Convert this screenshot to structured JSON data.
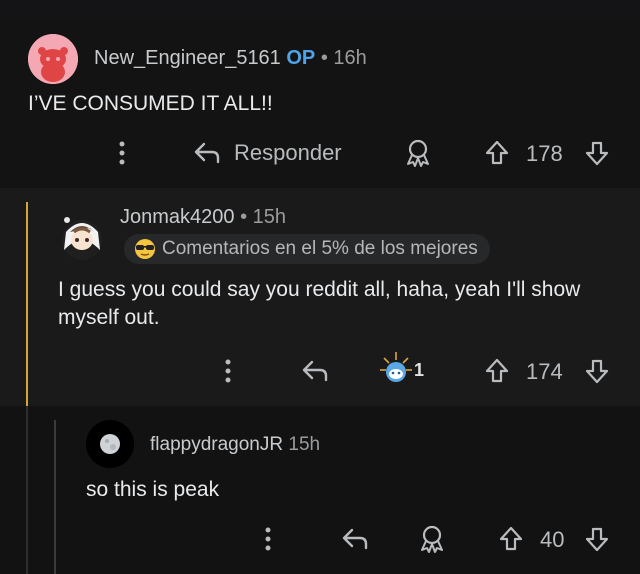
{
  "comments": [
    {
      "username": "New_Engineer_5161",
      "op_label": "OP",
      "separator": "•",
      "time": "16h",
      "body": "I’VE CONSUMED IT ALL!!",
      "reply_label": "Responder",
      "votes": "178",
      "icons": [
        "more-icon",
        "reply-icon",
        "award-icon",
        "upvote-icon",
        "downvote-icon"
      ]
    },
    {
      "username": "Jonmak4200",
      "separator": "•",
      "time": "15h",
      "badge": "Comentarios en el 5% de los mejores",
      "body": "I guess you could say you reddit all, haha, yeah I'll show myself out.",
      "award_count": "1",
      "votes": "174",
      "icons": [
        "more-icon",
        "reply-icon",
        "award-icon",
        "upvote-icon",
        "downvote-icon"
      ]
    },
    {
      "username": "flappydragonJR",
      "time": "15h",
      "body": "so this is peak",
      "votes": "40",
      "icons": [
        "more-icon",
        "reply-icon",
        "award-icon",
        "upvote-icon",
        "downvote-icon"
      ]
    }
  ],
  "colors": {
    "background": "#0e0e0f",
    "op_blue": "#4fa3e8",
    "thread_line_gold": "#d4a63a",
    "text": "#d7dadc"
  }
}
